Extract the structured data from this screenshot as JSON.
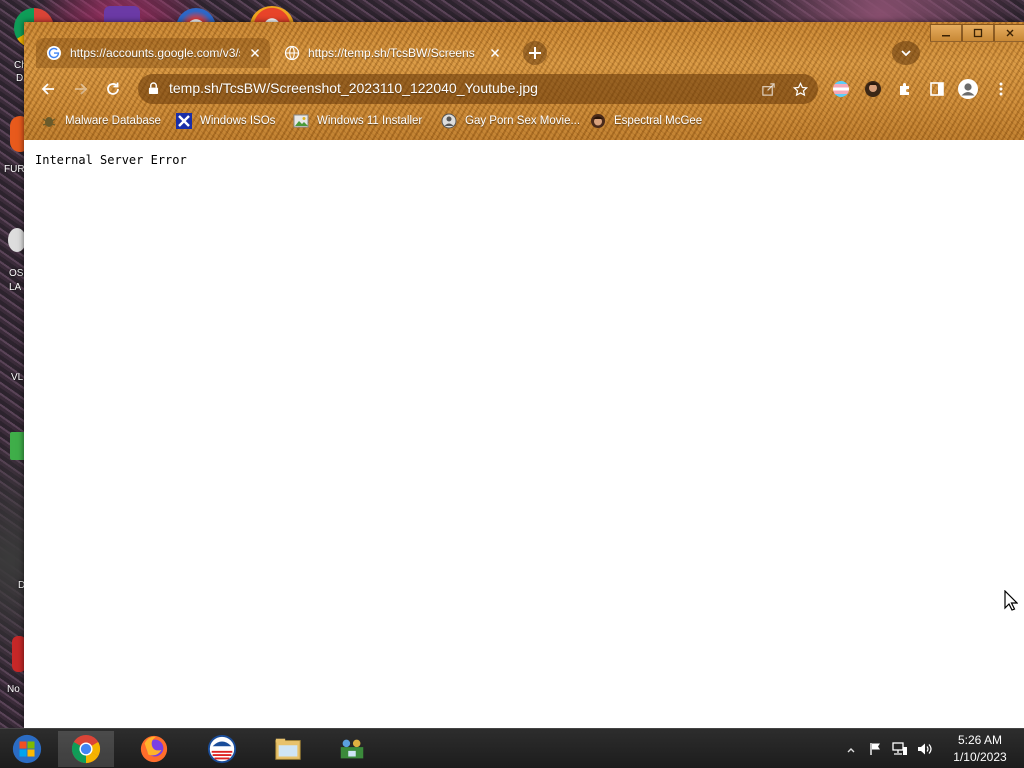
{
  "desktop": {
    "labels": [
      "Ch",
      "D",
      "FUR",
      "OS",
      "LA",
      "VL",
      "D",
      "No"
    ]
  },
  "browser": {
    "tabs": [
      {
        "title": "https://accounts.google.com/v3/s",
        "favicon": "google-g-icon",
        "active": true
      },
      {
        "title": "https://temp.sh/TcsBW/Screens",
        "favicon": "globe-icon",
        "active": false
      }
    ],
    "address_bar": {
      "url": "temp.sh/TcsBW/Screenshot_2023110_122040_Youtube.jpg"
    },
    "bookmarks": [
      {
        "label": "Malware Database",
        "icon": "bug-icon"
      },
      {
        "label": "Windows ISOs",
        "icon": "x-logo-icon"
      },
      {
        "label": "Windows 11 Installer",
        "icon": "image-icon"
      },
      {
        "label": "Gay Porn Sex Movie...",
        "icon": "site-icon"
      },
      {
        "label": "Espectral McGee",
        "icon": "avatar-icon"
      }
    ],
    "page": {
      "body_text": "Internal Server Error"
    },
    "theme_color": "#c98634"
  },
  "taskbar": {
    "apps": [
      "start-button",
      "chrome-icon",
      "firefox-icon",
      "obama-logo-icon",
      "file-explorer-icon",
      "network-users-icon"
    ],
    "clock": {
      "time": "5:26 AM",
      "date": "1/10/2023"
    }
  }
}
